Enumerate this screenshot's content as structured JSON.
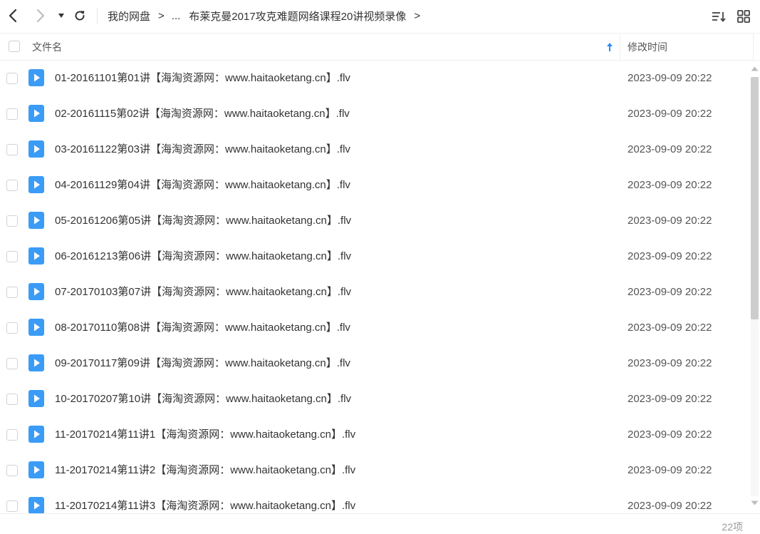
{
  "toolbar": {
    "back_icon": "chevron-left-icon",
    "forward_icon": "chevron-right-icon",
    "history_icon": "caret-down-icon",
    "refresh_icon": "refresh-icon",
    "sort_icon": "sort-list-icon",
    "view_icon": "grid-view-icon"
  },
  "breadcrumb": {
    "root": "我的网盘",
    "ellipsis": "...",
    "current": "布莱克曼2017攻克难题网络课程20讲视频录像",
    "separator": ">"
  },
  "header": {
    "name_label": "文件名",
    "time_label": "修改时间"
  },
  "files": [
    {
      "name": "01-20161101第01讲【海淘资源网：www.haitaoketang.cn】.flv",
      "time": "2023-09-09 20:22"
    },
    {
      "name": "02-20161115第02讲【海淘资源网：www.haitaoketang.cn】.flv",
      "time": "2023-09-09 20:22"
    },
    {
      "name": "03-20161122第03讲【海淘资源网：www.haitaoketang.cn】.flv",
      "time": "2023-09-09 20:22"
    },
    {
      "name": "04-20161129第04讲【海淘资源网：www.haitaoketang.cn】.flv",
      "time": "2023-09-09 20:22"
    },
    {
      "name": "05-20161206第05讲【海淘资源网：www.haitaoketang.cn】.flv",
      "time": "2023-09-09 20:22"
    },
    {
      "name": "06-20161213第06讲【海淘资源网：www.haitaoketang.cn】.flv",
      "time": "2023-09-09 20:22"
    },
    {
      "name": "07-20170103第07讲【海淘资源网：www.haitaoketang.cn】.flv",
      "time": "2023-09-09 20:22"
    },
    {
      "name": "08-20170110第08讲【海淘资源网：www.haitaoketang.cn】.flv",
      "time": "2023-09-09 20:22"
    },
    {
      "name": "09-20170117第09讲【海淘资源网：www.haitaoketang.cn】.flv",
      "time": "2023-09-09 20:22"
    },
    {
      "name": "10-20170207第10讲【海淘资源网：www.haitaoketang.cn】.flv",
      "time": "2023-09-09 20:22"
    },
    {
      "name": "11-20170214第11讲1【海淘资源网：www.haitaoketang.cn】.flv",
      "time": "2023-09-09 20:22"
    },
    {
      "name": "11-20170214第11讲2【海淘资源网：www.haitaoketang.cn】.flv",
      "time": "2023-09-09 20:22"
    },
    {
      "name": "11-20170214第11讲3【海淘资源网：www.haitaoketang.cn】.flv",
      "time": "2023-09-09 20:22"
    }
  ],
  "file_icon": "video-file-icon",
  "footer": {
    "count": "22项"
  },
  "colors": {
    "accent": "#2b8cf0",
    "video_icon": "#3a9cf6"
  }
}
